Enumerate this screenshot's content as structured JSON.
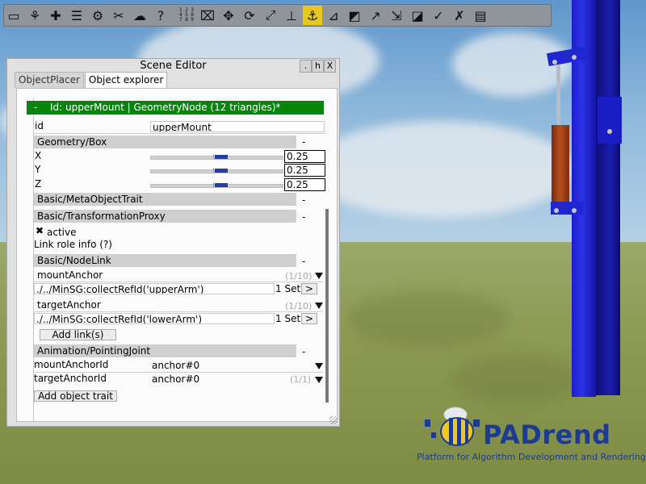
{
  "toolbar": {
    "items": [
      {
        "name": "folder-icon",
        "glyph": "▭"
      },
      {
        "name": "tree-icon",
        "glyph": "⚘"
      },
      {
        "name": "puzzle-icon",
        "glyph": "✚"
      },
      {
        "name": "list-icon",
        "glyph": "☰"
      },
      {
        "name": "gear-icon",
        "glyph": "⚙"
      },
      {
        "name": "tools-icon",
        "glyph": "✂"
      },
      {
        "name": "weather-icon",
        "glyph": "☁"
      },
      {
        "name": "help-icon",
        "glyph": "?"
      },
      {
        "name": "number-grid-icon",
        "glyph": "1 2 3\n4 5 6\n7 8 9"
      },
      {
        "name": "camera-icon",
        "glyph": "⌧"
      },
      {
        "name": "move-icon",
        "glyph": "✥"
      },
      {
        "name": "rotate-icon",
        "glyph": "⟳"
      },
      {
        "name": "scale-icon",
        "glyph": "⤢"
      },
      {
        "name": "snap-icon",
        "glyph": "⊥"
      },
      {
        "name": "anchor-icon",
        "glyph": "⚓"
      },
      {
        "name": "measure-icon",
        "glyph": "⊿"
      },
      {
        "name": "plane-select-icon",
        "glyph": "◩"
      },
      {
        "name": "arrow-transform-icon",
        "glyph": "↗"
      },
      {
        "name": "axis-icon",
        "glyph": "⇲"
      },
      {
        "name": "slash-select-icon",
        "glyph": "◪"
      },
      {
        "name": "check-plane-icon",
        "glyph": "✓"
      },
      {
        "name": "mark-plane-icon",
        "glyph": "✗"
      },
      {
        "name": "document-icon",
        "glyph": "▤"
      }
    ],
    "active_index": 14
  },
  "window": {
    "title": "Scene Editor",
    "buttons": [
      ".",
      "h",
      "X"
    ],
    "tabs": [
      "ObjectPlacer",
      "Object explorer"
    ],
    "selected_tab": 1
  },
  "node": {
    "collapse": "-",
    "header": "Id: upperMount | GeometryNode (12 triangles)*",
    "id_label": "id",
    "id_value": "upperMount"
  },
  "geometry": {
    "section": "Geometry/Box",
    "collapse": "-",
    "axes": [
      {
        "label": "X",
        "value": "0.25",
        "slider": 0.5
      },
      {
        "label": "Y",
        "value": "0.25",
        "slider": 0.5
      },
      {
        "label": "Z",
        "value": "0.25",
        "slider": 0.5
      }
    ]
  },
  "meta_trait": {
    "section": "Basic/MetaObjectTrait",
    "collapse": "-"
  },
  "transformation_proxy": {
    "section": "Basic/TransformationProxy",
    "collapse": "-",
    "check": "✖",
    "active_label": "active",
    "link_role_info": "Link role info (?)"
  },
  "node_link": {
    "section": "Basic/NodeLink",
    "collapse": "-",
    "links": [
      {
        "role": "mountAnchor",
        "counter": "(1/10)",
        "query": "./../MinSG:collectRefId('upperArm')",
        "set": "1 Set",
        "go": ">"
      },
      {
        "role": "targetAnchor",
        "counter": "(1/10)",
        "query": "./../MinSG:collectRefId('lowerArm')",
        "set": "1 Set",
        "go": ">"
      }
    ],
    "add_links": "Add link(s)"
  },
  "pointing_joint": {
    "section": "Animation/PointingJoint",
    "collapse": "-",
    "mount_label": "mountAnchorId",
    "mount_value": "anchor#0",
    "target_label": "targetAnchorId",
    "target_value": "anchor#0",
    "target_counter": "(1/1)"
  },
  "add_object_trait": "Add object trait",
  "logo": {
    "brand": "PADrend",
    "tagline": "Platform for Algorithm Development and Rendering"
  },
  "colors": {
    "accent_green": "#06840b",
    "active_tool": "#e7c81f",
    "robot_blue": "#2026d0",
    "logo_blue": "#1d3b93"
  }
}
